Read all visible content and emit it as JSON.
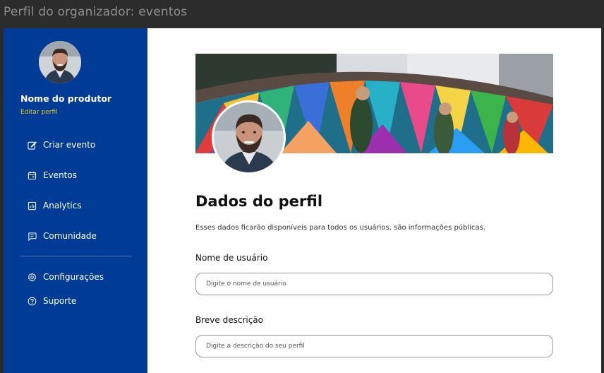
{
  "window": {
    "title": "Perfil do organizador: eventos"
  },
  "colors": {
    "sidebar_bg": "#003b95",
    "accent": "#f0c419",
    "window_bg": "#2c2c2c"
  },
  "sidebar": {
    "producer_name": "Nome do produtor",
    "edit_profile": "Editar perfil",
    "nav": [
      {
        "label": "Criar evento",
        "icon": "edit-icon"
      },
      {
        "label": "Eventos",
        "icon": "calendar-icon"
      },
      {
        "label": "Analytics",
        "icon": "analytics-icon"
      },
      {
        "label": "Comunidade",
        "icon": "chat-icon"
      }
    ],
    "secondary_nav": [
      {
        "label": "Configurações",
        "icon": "gear-icon"
      },
      {
        "label": "Suporte",
        "icon": "help-icon"
      }
    ]
  },
  "profile": {
    "title": "Dados do perfil",
    "description": "Esses dados ficarão disponíveis para todos os usuários, são informações públicas.",
    "fields": [
      {
        "label": "Nome de usuário",
        "placeholder": "Digite o nome de usuário",
        "value": ""
      },
      {
        "label": "Breve descrição",
        "placeholder": "Digite a descrição do seu perfil",
        "value": ""
      }
    ]
  }
}
